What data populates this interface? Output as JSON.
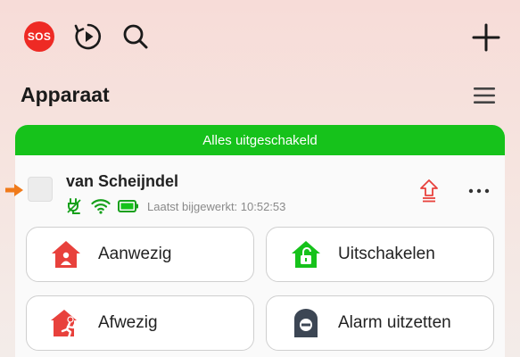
{
  "topbar": {
    "sos_label": "SOS",
    "icons": [
      "sos-icon",
      "replay-icon",
      "search-icon",
      "plus-icon"
    ]
  },
  "page": {
    "title": "Apparaat",
    "menu_icon": "hamburger-menu-icon"
  },
  "card": {
    "status_banner": "Alles uitgeschakeld",
    "device": {
      "name": "van Scheijndel",
      "last_updated": "Laatst bijgewerkt: 10:52:53",
      "status_icons": [
        "power-plug-icon",
        "wifi-icon",
        "battery-icon"
      ]
    },
    "actions": [
      {
        "label": "Aanwezig",
        "icon": "home-armed-icon",
        "color": "#e8413c"
      },
      {
        "label": "Uitschakelen",
        "icon": "home-disarmed-icon",
        "color": "#16c21b"
      },
      {
        "label": "Afwezig",
        "icon": "away-icon",
        "color": "#e8413c"
      },
      {
        "label": "Alarm uitzetten",
        "icon": "alarm-off-icon",
        "color": "#3c4654"
      }
    ]
  },
  "colors": {
    "accent_green": "#16c21b",
    "alert_red": "#e8413c",
    "indicator_orange": "#f07a1a"
  }
}
